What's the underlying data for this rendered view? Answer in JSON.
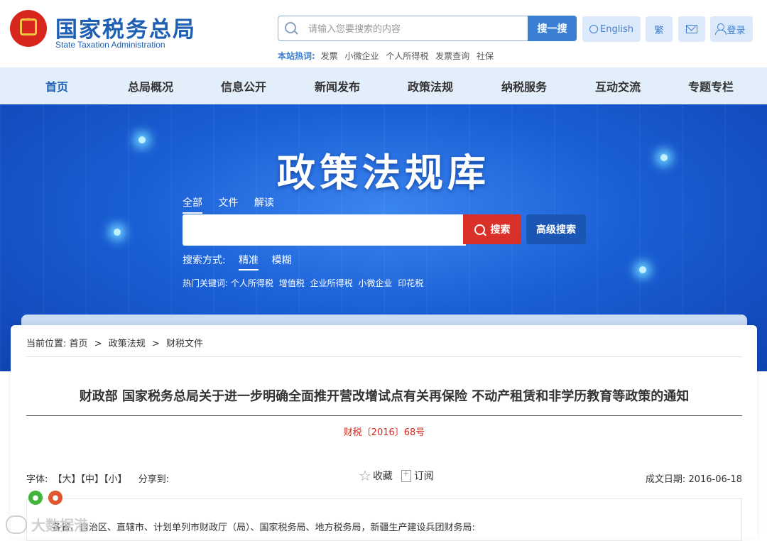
{
  "header": {
    "title_cn": "国家税务总局",
    "title_en": "State Taxation Administration",
    "search_placeholder": "请输入您要搜索的内容",
    "search_button": "搜一搜",
    "hot_label": "本站热词:",
    "hot_words": [
      "发票",
      "小微企业",
      "个人所得税",
      "发票查询",
      "社保"
    ],
    "english_label": "English",
    "traditional_label": "繁",
    "login_label": "登录"
  },
  "nav": {
    "items": [
      "首页",
      "总局概况",
      "信息公开",
      "新闻发布",
      "政策法规",
      "纳税服务",
      "互动交流",
      "专题专栏"
    ],
    "active": "首页"
  },
  "banner": {
    "title": "政策法规库",
    "tabs": [
      "全部",
      "文件",
      "解读"
    ],
    "search_button": "搜索",
    "advanced_button": "高级搜索",
    "mode_label": "搜索方式:",
    "modes": [
      "精准",
      "模糊"
    ],
    "hot_label": "热门关键词:",
    "hot_keywords": [
      "个人所得税",
      "增值税",
      "企业所得税",
      "小微企业",
      "印花税"
    ]
  },
  "article": {
    "breadcrumb_label": "当前位置:",
    "breadcrumb": [
      "首页",
      "政策法规",
      "财税文件"
    ],
    "breadcrumb_sep": ">",
    "title": "财政部 国家税务总局关于进一步明确全面推开营改增试点有关再保险 不动产租赁和非学历教育等政策的通知",
    "doc_number": "财税〔2016〕68号",
    "font_label": "字体:",
    "font_sizes": [
      "【大】",
      "【中】",
      "【小】"
    ],
    "share_label": "分享到:",
    "favorite_label": "收藏",
    "subscribe_label": "订阅",
    "date_label": "成文日期:",
    "date_value": "2016-06-18",
    "body_first_line": "各省、自治区、直辖市、计划单列市财政厅（局）、国家税务局、地方税务局，新疆生产建设兵团财务局:"
  },
  "watermark": "大数据港"
}
